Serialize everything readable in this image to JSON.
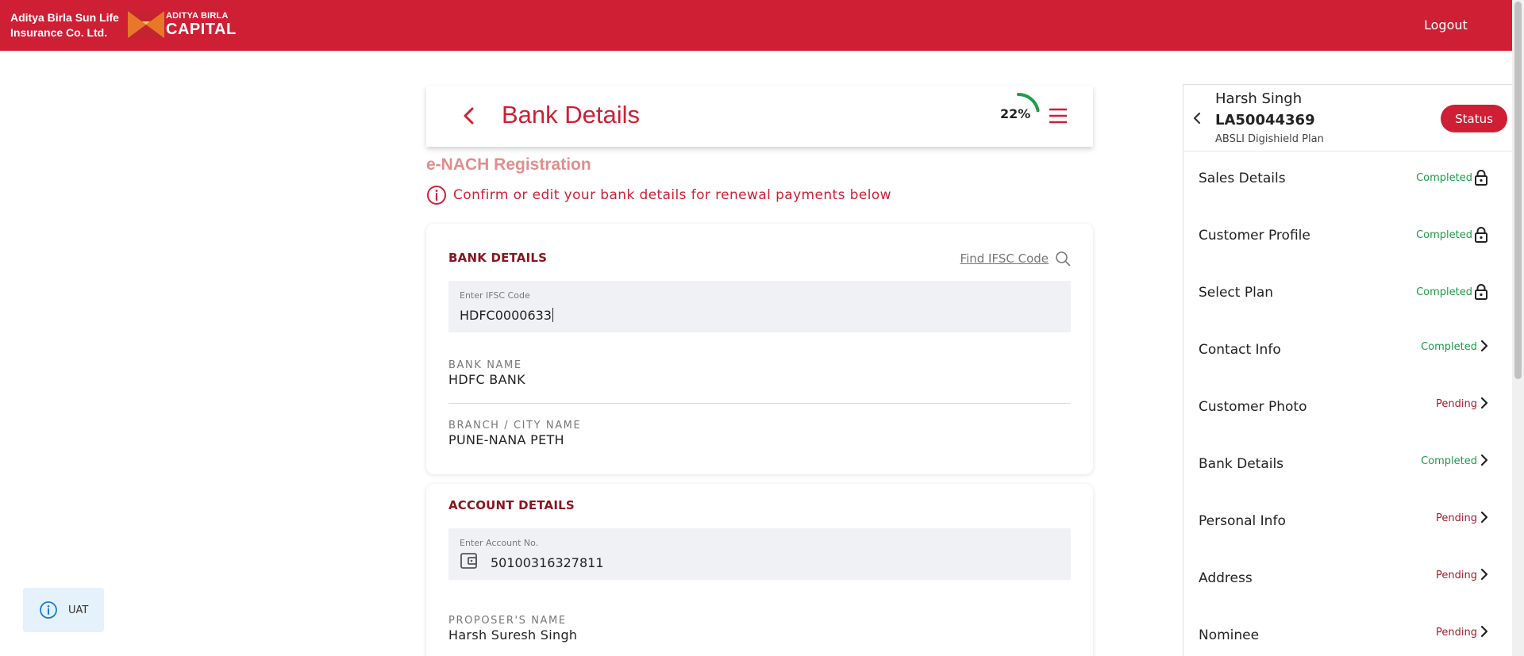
{
  "header": {
    "brand_line1": "Aditya Birla Sun Life",
    "brand_line2": "Insurance Co. Ltd.",
    "logo_line1": "ADITYA BIRLA",
    "logo_line2": "CAPITAL",
    "logout_label": "Logout"
  },
  "page": {
    "title": "Bank Details",
    "progress_text": "22%",
    "progress_fraction": 0.22,
    "section_title": "e-NACH Registration",
    "info_text": "Confirm or edit your bank details for renewal payments below"
  },
  "bank_card": {
    "heading": "BANK DETAILS",
    "find_ifsc_label": "Find IFSC Code",
    "ifsc_label": "Enter IFSC Code",
    "ifsc_value": "HDFC0000633",
    "bank_name_label": "BANK NAME",
    "bank_name_value": "HDFC BANK",
    "branch_label": "BRANCH / CITY NAME",
    "branch_value": "PUNE-NANA PETH"
  },
  "account_card": {
    "heading": "ACCOUNT DETAILS",
    "account_label": "Enter Account No.",
    "account_value": "50100316327811",
    "proposer_label": "PROPOSER'S NAME",
    "proposer_value": "Harsh Suresh Singh"
  },
  "panel": {
    "name": "Harsh Singh",
    "id": "LA50044369",
    "plan": "ABSLI Digishield Plan",
    "status_label": "Status",
    "steps": [
      {
        "label": "Sales Details",
        "status": "Completed",
        "icon": "lock-icon"
      },
      {
        "label": "Customer Profile",
        "status": "Completed",
        "icon": "lock-icon"
      },
      {
        "label": "Select Plan",
        "status": "Completed",
        "icon": "lock-icon"
      },
      {
        "label": "Contact Info",
        "status": "Completed",
        "icon": "chevron-right-icon"
      },
      {
        "label": "Customer Photo",
        "status": "Pending",
        "icon": "chevron-right-icon"
      },
      {
        "label": "Bank Details",
        "status": "Completed",
        "icon": "chevron-right-icon"
      },
      {
        "label": "Personal Info",
        "status": "Pending",
        "icon": "chevron-right-icon"
      },
      {
        "label": "Address",
        "status": "Pending",
        "icon": "chevron-right-icon"
      },
      {
        "label": "Nominee",
        "status": "Pending",
        "icon": "chevron-right-icon"
      }
    ]
  },
  "env_badge": {
    "label": "UAT"
  },
  "colors": {
    "brand_red": "#cf1f34",
    "completed_green": "#1e9b4b",
    "pending_red": "#a11d2e",
    "progress_green": "#1e9b4b"
  }
}
